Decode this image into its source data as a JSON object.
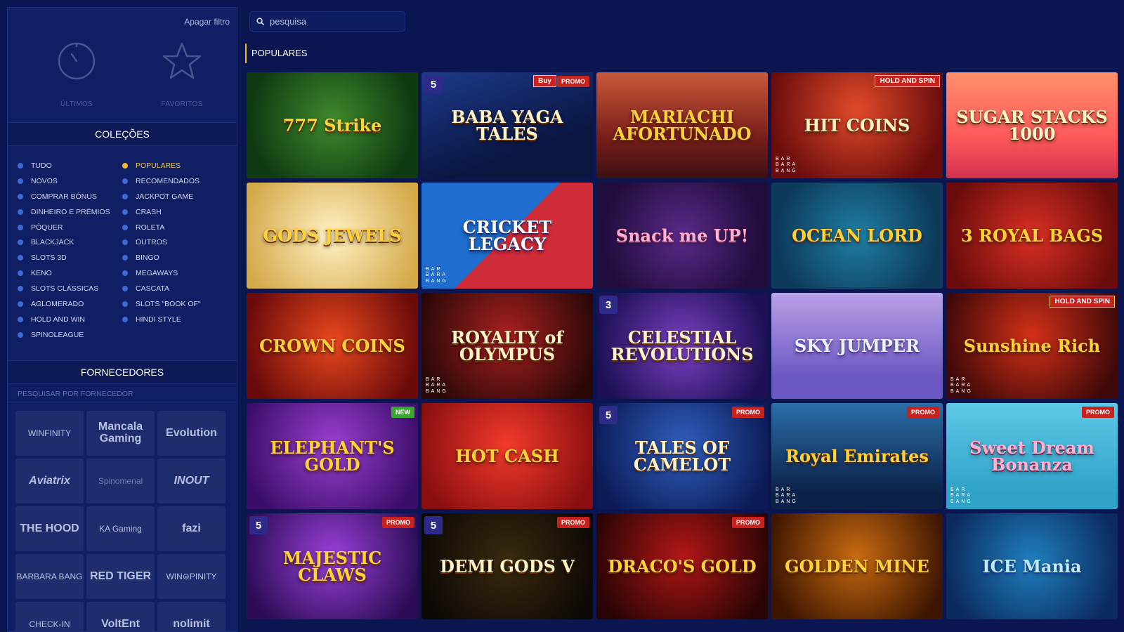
{
  "sidebar": {
    "clear_filter": "Apagar filtro",
    "quick": {
      "recent": "ÚLTIMOS",
      "favorites": "FAVORITOS"
    },
    "collections_title": "COLEÇÕES",
    "collections_col1": [
      "TUDO",
      "NOVOS",
      "COMPRAR BÓNUS",
      "DINHEIRO E PRÉMIOS",
      "PÓQUER",
      "BLACKJACK",
      "SLOTS 3D",
      "KENO",
      "SLOTS CLÁSSICAS",
      "AGLOMERADO",
      "HOLD AND WIN",
      "SPINOLEAGUE"
    ],
    "collections_col2": [
      "POPULARES",
      "RECOMENDADOS",
      "JACKPOT GAME",
      "CRASH",
      "ROLETA",
      "OUTROS",
      "BINGO",
      "MEGAWAYS",
      "CASCATA",
      "SLOTS \"BOOK OF\"",
      "HINDI STYLE"
    ],
    "active_collection": "POPULARES",
    "providers_title": "FORNECEDORES",
    "provider_search_placeholder": "PESQUISAR POR FORNECEDOR",
    "providers": [
      "WINFINITY",
      "Mancala Gaming",
      "Evolution",
      "Aviatrix",
      "Spinomenal",
      "INOUT",
      "THE HOOD",
      "KA Gaming",
      "fazi",
      "BARBARA BANG",
      "RED TIGER",
      "WIN⊜PINITY",
      "CHECK-IN",
      "VoltEnt",
      "nolimit"
    ]
  },
  "search": {
    "placeholder": "pesquisa"
  },
  "section": {
    "title": "POPULARES"
  },
  "games": [
    {
      "title": "777 Strike",
      "badge": ""
    },
    {
      "title": "BABA YAGA TALES",
      "badge": "PROMO",
      "strip": "Buy"
    },
    {
      "title": "MARIACHI AFORTUNADO",
      "badge": ""
    },
    {
      "title": "HIT COINS",
      "badge": "",
      "strip": "HOLD AND SPIN"
    },
    {
      "title": "SUGAR STACKS 1000",
      "badge": ""
    },
    {
      "title": "GODS JEWELS",
      "badge": ""
    },
    {
      "title": "CRICKET LEGACY",
      "badge": ""
    },
    {
      "title": "Snack me UP!",
      "badge": ""
    },
    {
      "title": "OCEAN LORD",
      "badge": ""
    },
    {
      "title": "3 ROYAL BAGS",
      "badge": ""
    },
    {
      "title": "CROWN COINS",
      "badge": ""
    },
    {
      "title": "ROYALTY of OLYMPUS",
      "badge": ""
    },
    {
      "title": "CELESTIAL REVOLUTIONS",
      "badge": ""
    },
    {
      "title": "SKY JUMPER",
      "badge": ""
    },
    {
      "title": "Sunshine Rich",
      "badge": "",
      "strip": "HOLD AND SPIN"
    },
    {
      "title": "ELEPHANT'S GOLD",
      "badge": "NEW"
    },
    {
      "title": "HOT CASH",
      "badge": ""
    },
    {
      "title": "TALES OF CAMELOT",
      "badge": "PROMO"
    },
    {
      "title": "Royal Emirates",
      "badge": "PROMO"
    },
    {
      "title": "Sweet Dream Bonanza",
      "badge": "PROMO"
    },
    {
      "title": "MAJESTIC CLAWS",
      "badge": "PROMO"
    },
    {
      "title": "DEMI GODS V",
      "badge": "PROMO"
    },
    {
      "title": "DRACO'S GOLD",
      "badge": "PROMO"
    },
    {
      "title": "GOLDEN MINE",
      "badge": ""
    },
    {
      "title": "ICE Mania",
      "badge": ""
    }
  ],
  "colors": {
    "accent": "#f2b82c",
    "bg": "#0b1650",
    "panel": "#101f63",
    "promo": "#c8221f",
    "new": "#3aa82d"
  }
}
